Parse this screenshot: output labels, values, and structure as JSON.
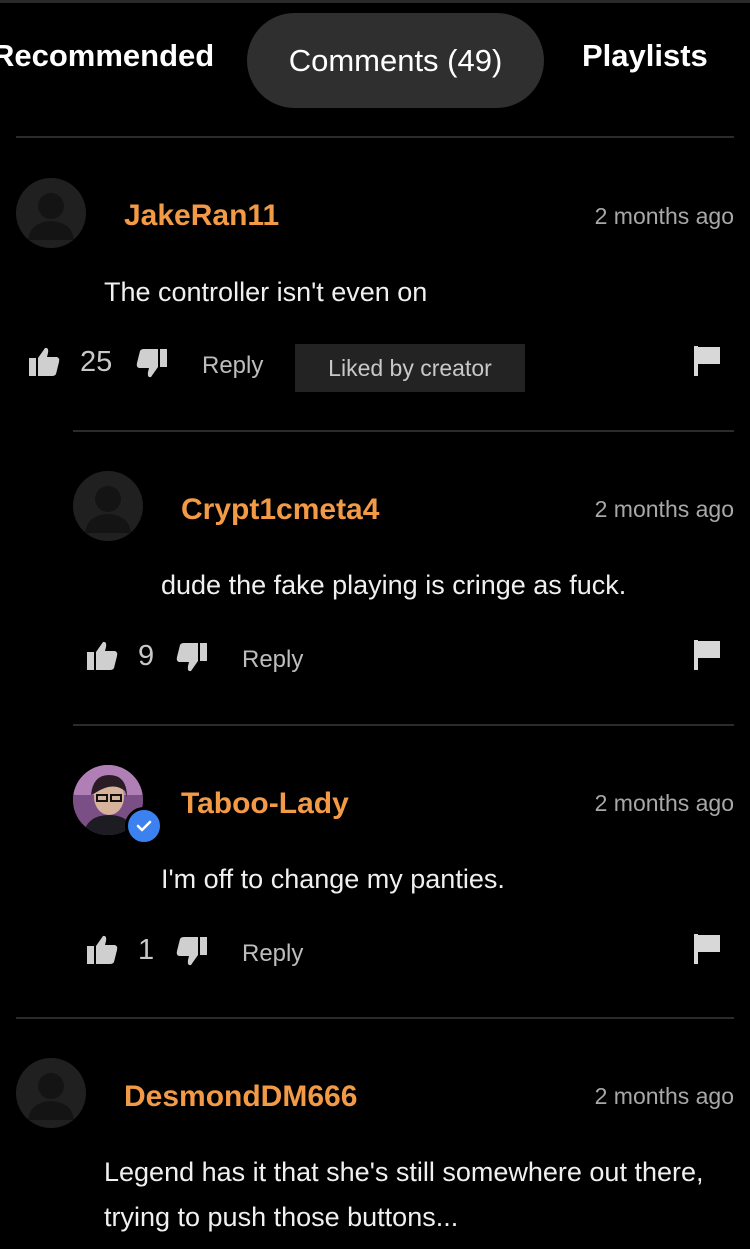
{
  "tabs": [
    {
      "label": "Recommended"
    },
    {
      "label": "Comments (49)",
      "active": true
    },
    {
      "label": "Playlists"
    }
  ],
  "colors": {
    "username": "#f29a45",
    "background": "#000000",
    "active_tab_bg": "#2f2f2f",
    "verified_badge": "#3b82f0"
  },
  "comments": [
    {
      "username": "JakeRan11",
      "time": "2 months ago",
      "text": "The controller isn't even on",
      "likes": "25",
      "reply_label": "Reply",
      "badge": "Liked by creator",
      "avatar_icon": "default-avatar-icon",
      "reply": false
    },
    {
      "username": "Crypt1cmeta4",
      "time": "2 months ago",
      "text": "dude the fake playing is cringe as fuck.",
      "likes": "9",
      "reply_label": "Reply",
      "avatar_icon": "default-avatar-icon",
      "reply": true
    },
    {
      "username": "Taboo-Lady",
      "time": "2 months ago",
      "text": "I'm off to change my panties.",
      "likes": "1",
      "reply_label": "Reply",
      "avatar_icon": "user-photo-avatar",
      "verified": true,
      "reply": true
    },
    {
      "username": "DesmondDM666",
      "time": "2 months ago",
      "text": "Legend has it that she's still somewhere out there, trying to push those buttons...",
      "avatar_icon": "default-avatar-icon",
      "reply": false
    }
  ]
}
